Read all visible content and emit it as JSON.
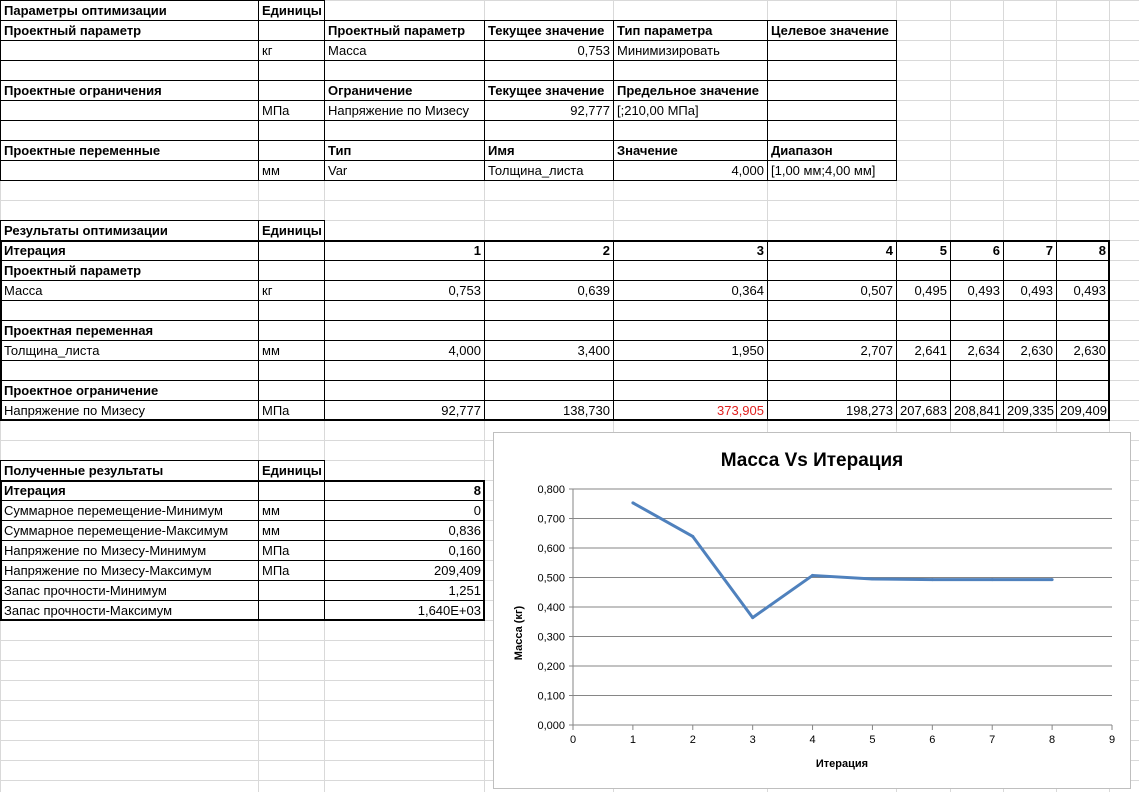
{
  "params": {
    "title": "Параметры оптимизации",
    "units": "Единицы",
    "dp_label": "Проектный параметр",
    "dp_headers": [
      "Проектный параметр",
      "Текущее значение",
      "Тип параметра",
      "Целевое значение"
    ],
    "dp_row": {
      "unit": "кг",
      "name": "Масса",
      "value": "0,753",
      "type": "Минимизировать",
      "target": ""
    },
    "dc_label": "Проектные ограничения",
    "dc_headers": [
      "Ограничение",
      "Текущее значение",
      "Предельное значение"
    ],
    "dc_row": {
      "unit": "МПа",
      "name": "Напряжение по Мизесу",
      "value": "92,777",
      "limit": "[;210,00 МПа]"
    },
    "dv_label": "Проектные переменные",
    "dv_headers": [
      "Тип",
      "Имя",
      "Значение",
      "Диапазон"
    ],
    "dv_row": {
      "unit": "мм",
      "type": "Var",
      "name": "Толщина_листа",
      "value": "4,000",
      "range": "[1,00 мм;4,00 мм]"
    }
  },
  "results": {
    "title": "Результаты оптимизации",
    "units": "Единицы",
    "iter_label": "Итерация",
    "iterations": [
      "1",
      "2",
      "3",
      "4",
      "5",
      "6",
      "7",
      "8"
    ],
    "dp_label": "Проектный параметр",
    "mass": {
      "name": "Масса",
      "unit": "кг",
      "values": [
        "0,753",
        "0,639",
        "0,364",
        "0,507",
        "0,495",
        "0,493",
        "0,493",
        "0,493"
      ]
    },
    "dv_label": "Проектная переменная",
    "thick": {
      "name": "Толщина_листа",
      "unit": "мм",
      "values": [
        "4,000",
        "3,400",
        "1,950",
        "2,707",
        "2,641",
        "2,634",
        "2,630",
        "2,630"
      ]
    },
    "dc_label": "Проектное ограничение",
    "stress": {
      "name": "Напряжение по Мизесу",
      "unit": "МПа",
      "values": [
        "92,777",
        "138,730",
        "373,905",
        "198,273",
        "207,683",
        "208,841",
        "209,335",
        "209,409"
      ],
      "violated_index": 2
    }
  },
  "obtained": {
    "title": "Полученные результаты",
    "units": "Единицы",
    "rows": [
      {
        "name": "Итерация",
        "unit": "",
        "value": "8",
        "bold": true
      },
      {
        "name": "Суммарное перемещение-Минимум",
        "unit": "мм",
        "value": "0"
      },
      {
        "name": "Суммарное перемещение-Максимум",
        "unit": "мм",
        "value": "0,836"
      },
      {
        "name": "Напряжение по Мизесу-Минимум",
        "unit": "МПа",
        "value": "0,160"
      },
      {
        "name": "Напряжение по Мизесу-Максимум",
        "unit": "МПа",
        "value": "209,409"
      },
      {
        "name": "Запас прочности-Минимум",
        "unit": "",
        "value": "1,251"
      },
      {
        "name": "Запас прочности-Максимум",
        "unit": "",
        "value": "1,640E+03"
      }
    ]
  },
  "colors": {
    "line": "#4f81bd",
    "violation": "#e0201f"
  },
  "chart_data": {
    "type": "line",
    "title": "Масса Vs Итерация",
    "xlabel": "Итерация",
    "ylabel": "Масса  (кг)",
    "xlim": [
      0,
      9
    ],
    "ylim": [
      0,
      0.8
    ],
    "x_ticks": [
      "0",
      "1",
      "2",
      "3",
      "4",
      "5",
      "6",
      "7",
      "8",
      "9"
    ],
    "y_ticks": [
      "0,000",
      "0,100",
      "0,200",
      "0,300",
      "0,400",
      "0,500",
      "0,600",
      "0,700",
      "0,800"
    ],
    "grid": "horizontal",
    "series": [
      {
        "x": [
          1,
          2,
          3,
          4,
          5,
          6,
          7,
          8
        ],
        "values": [
          0.753,
          0.639,
          0.364,
          0.507,
          0.495,
          0.493,
          0.493,
          0.493
        ]
      }
    ]
  }
}
